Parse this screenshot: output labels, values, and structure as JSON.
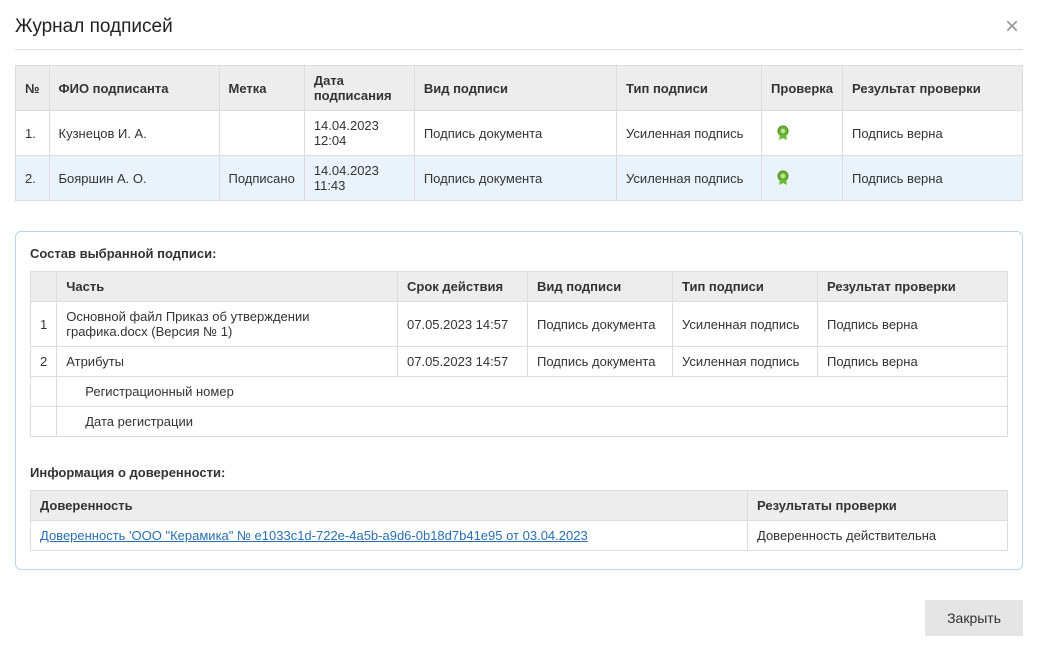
{
  "header": {
    "title": "Журнал подписей"
  },
  "signatures": {
    "columns": {
      "num": "№",
      "signer": "ФИО подписанта",
      "label": "Метка",
      "date": "Дата подписания",
      "view": "Вид подписи",
      "type": "Тип подписи",
      "check": "Проверка",
      "result": "Результат проверки"
    },
    "rows": [
      {
        "num": "1.",
        "signer": "Кузнецов И. А.",
        "label": "",
        "date": "14.04.2023 12:04",
        "view": "Подпись документа",
        "type": "Усиленная подпись",
        "result": "Подпись верна"
      },
      {
        "num": "2.",
        "signer": "Бояршин А. О.",
        "label": "Подписано",
        "date": "14.04.2023 11:43",
        "view": "Подпись документа",
        "type": "Усиленная подпись",
        "result": "Подпись верна"
      }
    ]
  },
  "composition": {
    "title": "Состав выбранной подписи:",
    "columns": {
      "part": "Часть",
      "validity": "Срок действия",
      "view": "Вид подписи",
      "type": "Тип подписи",
      "result": "Результат проверки"
    },
    "rows": [
      {
        "idx": "1",
        "part": "Основной файл Приказ об утверждении графика.docx (Версия № 1)",
        "validity": "07.05.2023 14:57",
        "view": "Подпись документа",
        "type": "Усиленная подпись",
        "result": "Подпись верна"
      },
      {
        "idx": "2",
        "part": "Атрибуты",
        "validity": "07.05.2023 14:57",
        "view": "Подпись документа",
        "type": "Усиленная подпись",
        "result": "Подпись верна"
      }
    ],
    "sub_rows": [
      {
        "label": "Регистрационный номер"
      },
      {
        "label": "Дата регистрации"
      }
    ]
  },
  "authority": {
    "title": "Информация о доверенности:",
    "columns": {
      "authority": "Доверенность",
      "results": "Результаты проверки"
    },
    "row": {
      "link": "Доверенность 'ООО \"Керамика\" № e1033c1d-722e-4a5b-a9d6-0b18d7b41e95 от 03.04.2023",
      "result": "Доверенность действительна"
    }
  },
  "footer": {
    "close": "Закрыть"
  }
}
